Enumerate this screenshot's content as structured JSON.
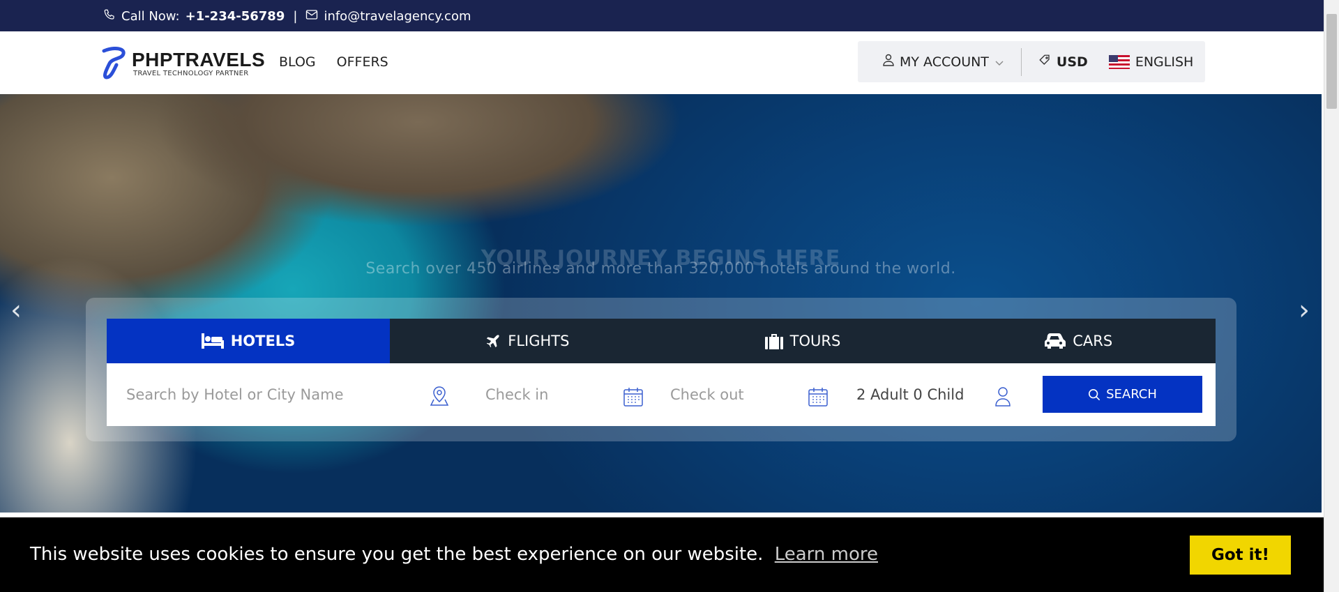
{
  "topbar": {
    "call_label": "Call Now:",
    "phone": "+1-234-56789",
    "separator": "|",
    "email": "info@travelagency.com"
  },
  "header": {
    "logo_title": "PHPTRAVELS",
    "logo_subtitle": "TRAVEL TECHNOLOGY PARTNER",
    "nav": [
      {
        "label": "BLOG"
      },
      {
        "label": "OFFERS"
      }
    ],
    "account_label": "MY ACCOUNT",
    "currency": "USD",
    "language": "ENGLISH"
  },
  "hero": {
    "title": "YOUR JOURNEY BEGINS HERE",
    "subtitle": "Search over 450 airlines and more than 320,000 hotels around the world."
  },
  "search": {
    "tabs": [
      {
        "label": "HOTELS",
        "icon": "bed-icon"
      },
      {
        "label": "FLIGHTS",
        "icon": "plane-icon"
      },
      {
        "label": "TOURS",
        "icon": "suitcase-icon"
      },
      {
        "label": "CARS",
        "icon": "car-icon"
      }
    ],
    "destination_placeholder": "Search by Hotel or City Name",
    "checkin_placeholder": "Check in",
    "checkout_placeholder": "Check out",
    "guests_value": "2 Adult 0 Child",
    "search_label": "SEARCH"
  },
  "cookie": {
    "message": "This website uses cookies to ensure you get the best experience on our website.",
    "learn_more": "Learn more",
    "accept": "Got it!"
  },
  "colors": {
    "topbar_bg": "#1a2350",
    "primary": "#0433c2",
    "tabbar_bg": "#1a2633",
    "cookie_button": "#f1d600"
  }
}
